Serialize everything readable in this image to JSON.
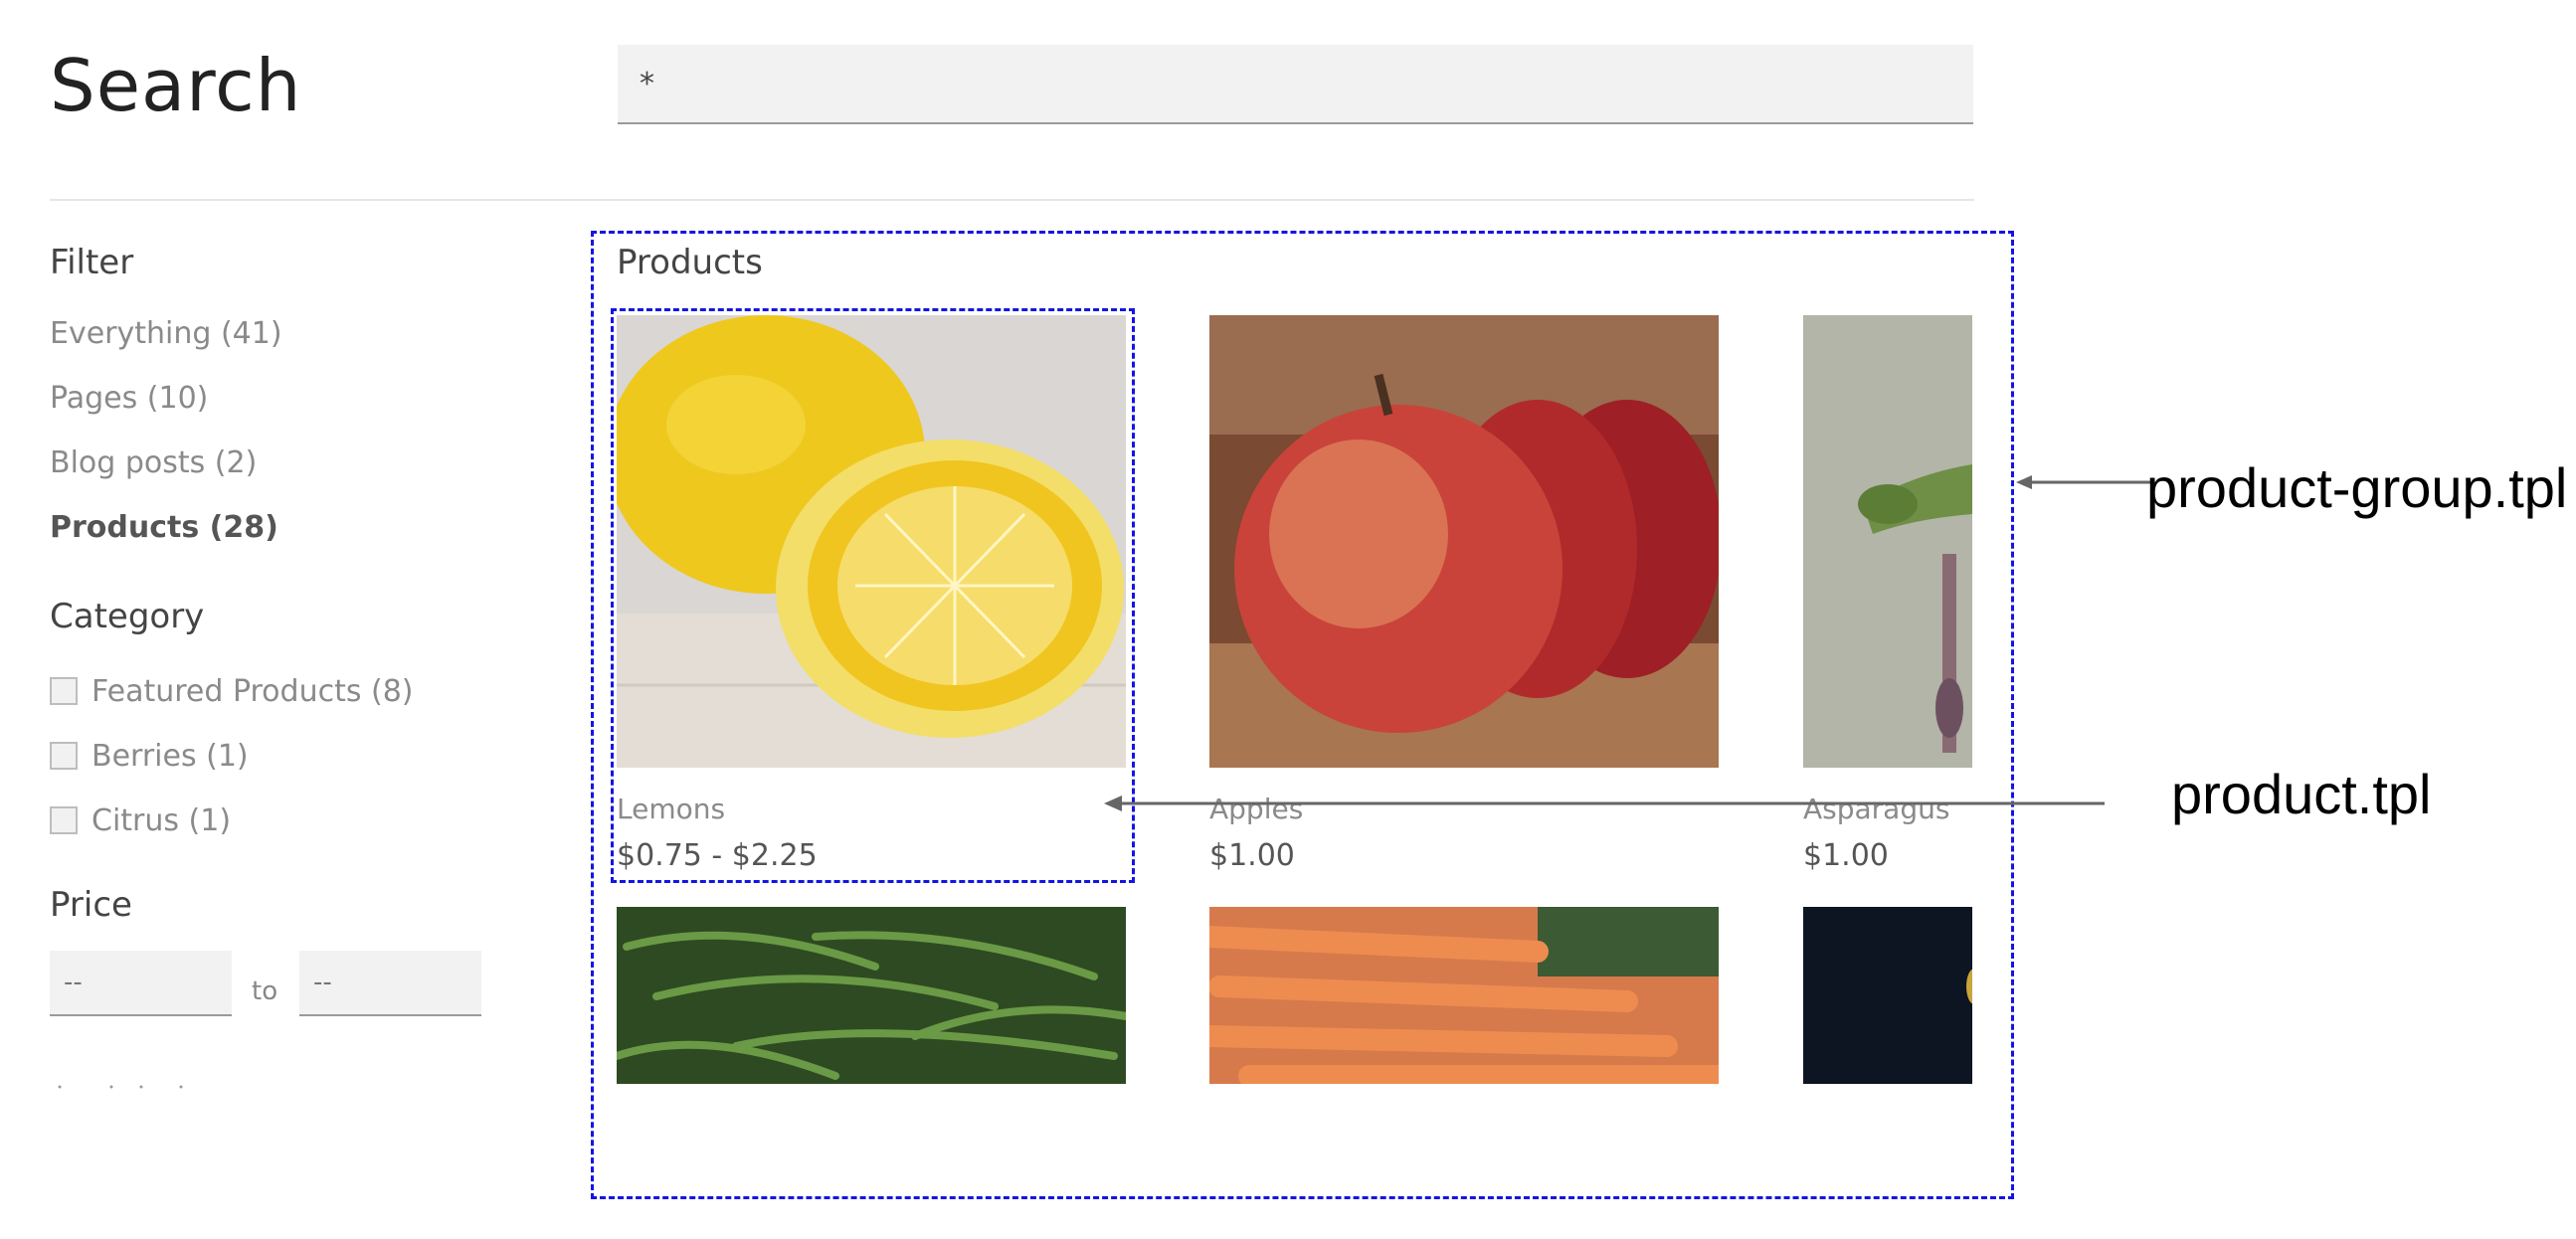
{
  "header": {
    "title": "Search",
    "search_value": "*"
  },
  "sidebar": {
    "filter_heading": "Filter",
    "filters": [
      {
        "label": "Everything (41)",
        "active": false
      },
      {
        "label": "Pages (10)",
        "active": false
      },
      {
        "label": "Blog posts (2)",
        "active": false
      },
      {
        "label": "Products (28)",
        "active": true
      }
    ],
    "category_heading": "Category",
    "categories": [
      {
        "label": "Featured Products (8)",
        "checked": false
      },
      {
        "label": "Berries (1)",
        "checked": false
      },
      {
        "label": "Citrus (1)",
        "checked": false
      }
    ],
    "price_heading": "Price",
    "price_min_placeholder": "--",
    "price_max_placeholder": "--",
    "price_to": "to"
  },
  "main": {
    "products_heading": "Products",
    "products": [
      {
        "name": "Lemons",
        "price": "$0.75 - $2.25",
        "image": "lemons-photo"
      },
      {
        "name": "Apples",
        "price": "$1.00",
        "image": "apples-photo"
      },
      {
        "name": "Asparagus",
        "price": "$1.00",
        "image": "asparagus-photo"
      },
      {
        "name": "",
        "price": "",
        "image": "green-beans-photo"
      },
      {
        "name": "",
        "price": "",
        "image": "carrots-photo"
      },
      {
        "name": "",
        "price": "",
        "image": "dark-produce-photo"
      }
    ]
  },
  "annotations": {
    "group_label": "product-group.tpl",
    "product_label": "product.tpl",
    "outline_color": "#1414e6",
    "arrow_color": "#666666"
  }
}
